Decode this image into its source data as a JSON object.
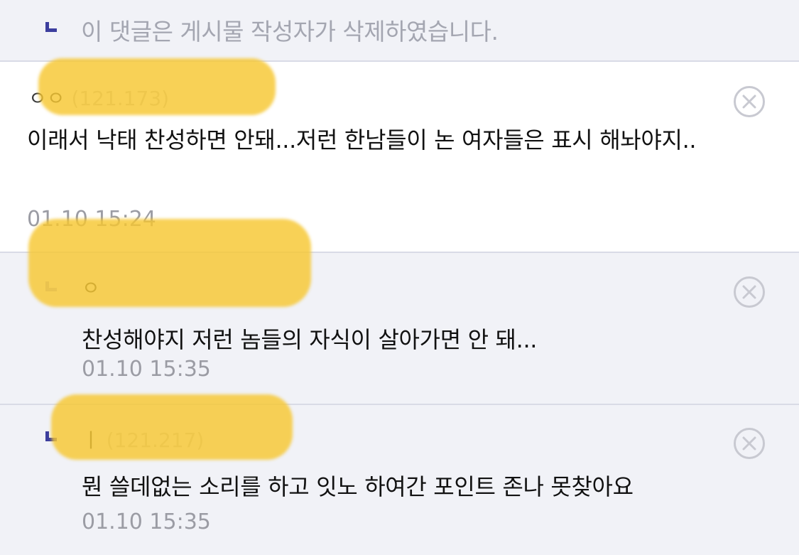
{
  "deleted_notice": {
    "text": "이 댓글은 게시물 작성자가 삭제하였습니다."
  },
  "comments": [
    {
      "author_name": "ㅇㅇ",
      "author_ip": "(121.173)",
      "text": "이래서 낙태 찬성하면 안돼...저런 한남들이 논 여자들은 표시 해놔야지..",
      "time": "01.10 15:24"
    },
    {
      "author_name": "ㅇ",
      "author_ip": "",
      "text": "찬성해야지 저런 놈들의 자식이 살아가면 안 돼...",
      "time": "01.10 15:35"
    },
    {
      "author_name": "ㅣ",
      "author_ip": "(121.217)",
      "text": "뭔 쓸데없는 소리를 하고 잇노 하여간 포인트 존나 못찾아요",
      "time": "01.10 15:35"
    }
  ],
  "colors": {
    "reply_marker": "#3c3e9e",
    "row_alt_background": "#f1f2f7",
    "divider": "#d9dbe6",
    "timestamp": "#9b9ca4",
    "highlight": "#f6c731"
  },
  "icons": {
    "reply_marker": "reply-arrow-icon",
    "delete": "close-circle-icon"
  }
}
